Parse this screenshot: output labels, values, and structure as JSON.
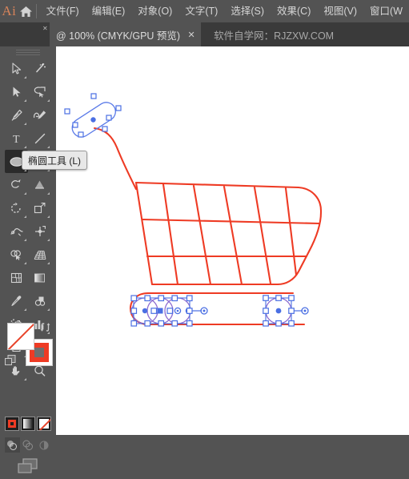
{
  "app": {
    "logo_text": "Ai",
    "home_icon": "home-icon"
  },
  "menubar": {
    "items": [
      {
        "label": "文件(F)"
      },
      {
        "label": "编辑(E)"
      },
      {
        "label": "对象(O)"
      },
      {
        "label": "文字(T)"
      },
      {
        "label": "选择(S)"
      },
      {
        "label": "效果(C)"
      },
      {
        "label": "视图(V)"
      },
      {
        "label": "窗口(W"
      }
    ]
  },
  "tabbar": {
    "active_tab": {
      "title": "@ 100% (CMYK/GPU 预览)",
      "close_label": "✕"
    },
    "inactive_tab": {
      "title": "软件自学网：RJZXW.COM"
    }
  },
  "tooltip": {
    "text": "椭圆工具 (L)"
  },
  "toolbar": {
    "tools": [
      {
        "name": "selection-tool",
        "label": "选择工具"
      },
      {
        "name": "magic-wand-tool",
        "label": "魔棒工具"
      },
      {
        "name": "direct-selection-tool",
        "label": "直接选择工具"
      },
      {
        "name": "lasso-tool",
        "label": "套索工具"
      },
      {
        "name": "pen-tool",
        "label": "钢笔工具"
      },
      {
        "name": "curvature-tool",
        "label": "曲率工具"
      },
      {
        "name": "type-tool",
        "label": "文字工具"
      },
      {
        "name": "line-segment-tool",
        "label": "直线段工具"
      },
      {
        "name": "ellipse-tool",
        "label": "椭圆工具",
        "active": true
      },
      {
        "name": "paintbrush-tool",
        "label": "画笔工具"
      },
      {
        "name": "shaper-tool",
        "label": "Shaper 工具"
      },
      {
        "name": "eraser-tool",
        "label": "橡皮擦工具"
      },
      {
        "name": "rotate-tool",
        "label": "旋转工具"
      },
      {
        "name": "scale-tool",
        "label": "比例缩放工具"
      },
      {
        "name": "width-tool",
        "label": "宽度工具"
      },
      {
        "name": "free-transform-tool",
        "label": "自由变换工具"
      },
      {
        "name": "shape-builder-tool",
        "label": "形状生成器工具"
      },
      {
        "name": "perspective-grid-tool",
        "label": "透视网格工具"
      },
      {
        "name": "mesh-tool",
        "label": "网格工具"
      },
      {
        "name": "gradient-tool",
        "label": "渐变工具"
      },
      {
        "name": "eyedropper-tool",
        "label": "吸管工具"
      },
      {
        "name": "blend-tool",
        "label": "混合工具"
      },
      {
        "name": "symbol-sprayer-tool",
        "label": "符号喷枪工具"
      },
      {
        "name": "column-graph-tool",
        "label": "柱形图工具"
      },
      {
        "name": "artboard-tool",
        "label": "画板工具"
      },
      {
        "name": "slice-tool",
        "label": "切片工具"
      },
      {
        "name": "hand-tool",
        "label": "抓手工具"
      },
      {
        "name": "zoom-tool",
        "label": "缩放工具"
      }
    ],
    "colors": {
      "fill": "#FFFFFF",
      "fill_state": "none",
      "stroke": "#EE3B24",
      "accent": "#EE3B24"
    },
    "paint_modes": [
      {
        "name": "color-mode",
        "selected": true
      },
      {
        "name": "gradient-mode",
        "selected": false
      },
      {
        "name": "none-mode",
        "selected": false
      }
    ],
    "draw_modes": [
      {
        "name": "draw-normal",
        "selected": true
      },
      {
        "name": "draw-behind",
        "selected": false
      },
      {
        "name": "draw-inside",
        "selected": false
      }
    ],
    "screen_mode": {
      "name": "screen-mode-button"
    }
  },
  "canvas": {
    "zoom": "100%",
    "artwork_name": "shopping-cart-artwork",
    "stroke_color": "#EE3B24",
    "selection_color": "#4A6FE3",
    "objects": [
      {
        "name": "cart-handle",
        "selected": true
      },
      {
        "name": "cart-basket",
        "selected": false
      },
      {
        "name": "cart-base-rail",
        "selected": false
      },
      {
        "name": "wheel-group-left",
        "selected": true
      },
      {
        "name": "wheel-right",
        "selected": true
      }
    ]
  }
}
